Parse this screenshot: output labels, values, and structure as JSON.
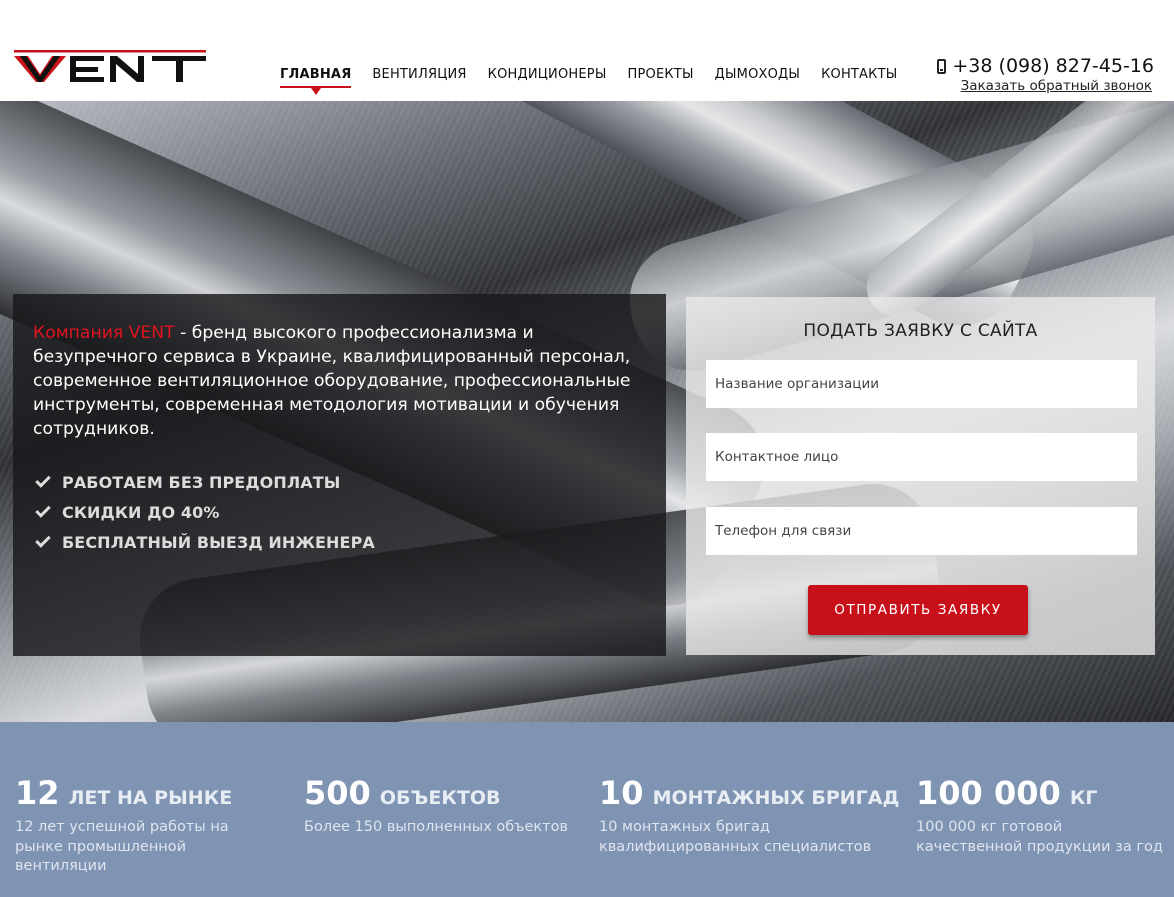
{
  "header": {
    "logo_text": "VENT",
    "nav": [
      {
        "label": "ГЛАВНАЯ",
        "active": true
      },
      {
        "label": "ВЕНТИЛЯЦИЯ",
        "active": false
      },
      {
        "label": "КОНДИЦИОНЕРЫ",
        "active": false
      },
      {
        "label": "ПРОЕКТЫ",
        "active": false
      },
      {
        "label": "ДЫМОХОДЫ",
        "active": false
      },
      {
        "label": "КОНТАКТЫ",
        "active": false
      }
    ],
    "phone": "+38 (098) 827-45-16",
    "callback_link": "Заказать обратный звонок"
  },
  "hero": {
    "intro_brand": "Компания VENT",
    "intro_text": " - бренд высокого профессионализма и безупречного сервиса в Украине, квалифицированный персонал, современное вентиляционное оборудование, профессиональные инструменты, современная методология мотивации и обучения сотрудников.",
    "benefits": [
      "РАБОТАЕМ БЕЗ ПРЕДОПЛАТЫ",
      "СКИДКИ ДО 40%",
      "БЕСПЛАТНЫЙ ВЫЕЗД ИНЖЕНЕРА"
    ]
  },
  "form": {
    "title": "ПОДАТЬ ЗАЯВКУ С САЙТА",
    "fields": [
      {
        "placeholder": "Название организации",
        "value": ""
      },
      {
        "placeholder": "Контактное лицо",
        "value": ""
      },
      {
        "placeholder": "Телефон для связи",
        "value": ""
      }
    ],
    "submit_label": "ОТПРАВИТЬ ЗАЯВКУ"
  },
  "stats": [
    {
      "number": "12",
      "label": "ЛЕТ НА РЫНКЕ",
      "desc": "12 лет успешной работы на рынке промышленной вентиляции"
    },
    {
      "number": "500",
      "label": "ОБЪЕКТОВ",
      "desc": "Более 150 выполненных объектов"
    },
    {
      "number": "10",
      "label": "МОНТАЖНЫХ БРИГАД",
      "desc": "10 монтажных бригад квалифицированных специалистов"
    },
    {
      "number": "100 000",
      "label": "КГ",
      "desc": "100 000 кг готовой качественной продукции за год"
    }
  ],
  "colors": {
    "brand_red": "#c8101a",
    "stats_bg": "#7f93b3"
  },
  "icons": [
    "vent-logo",
    "phone-icon",
    "check-icon",
    "nav-active-arrow-icon"
  ]
}
